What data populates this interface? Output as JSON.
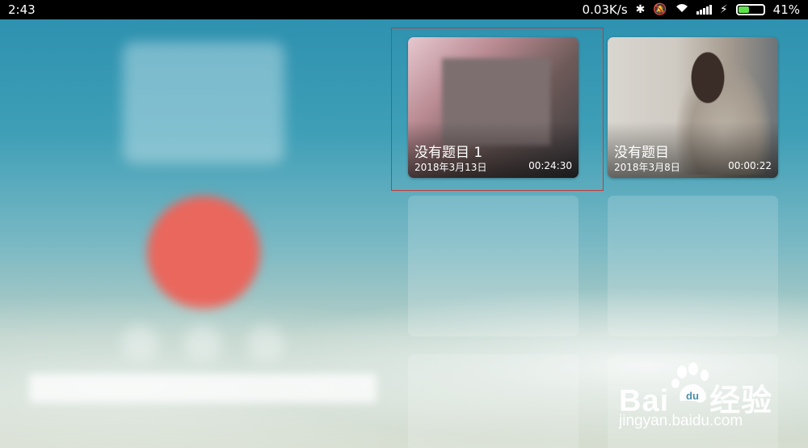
{
  "status_bar": {
    "time": "2:43",
    "net_speed": "0.03K/s",
    "battery_percent": "41%",
    "battery_level": 0.41,
    "icons": [
      "bluetooth-icon",
      "mute-vibrate-icon",
      "wifi-icon",
      "signal-icon",
      "charging-icon",
      "battery-icon"
    ]
  },
  "recordings": [
    {
      "title": "没有题目 1",
      "date": "2018年3月13日",
      "duration": "00:24:30",
      "selected": true
    },
    {
      "title": "没有题目",
      "date": "2018年3月8日",
      "duration": "00:00:22",
      "selected": false
    }
  ],
  "selection_color": "#c23a3a",
  "watermark": {
    "brand": "Bai",
    "brand_suffix": "经验",
    "url": "jingyan.baidu.com"
  }
}
